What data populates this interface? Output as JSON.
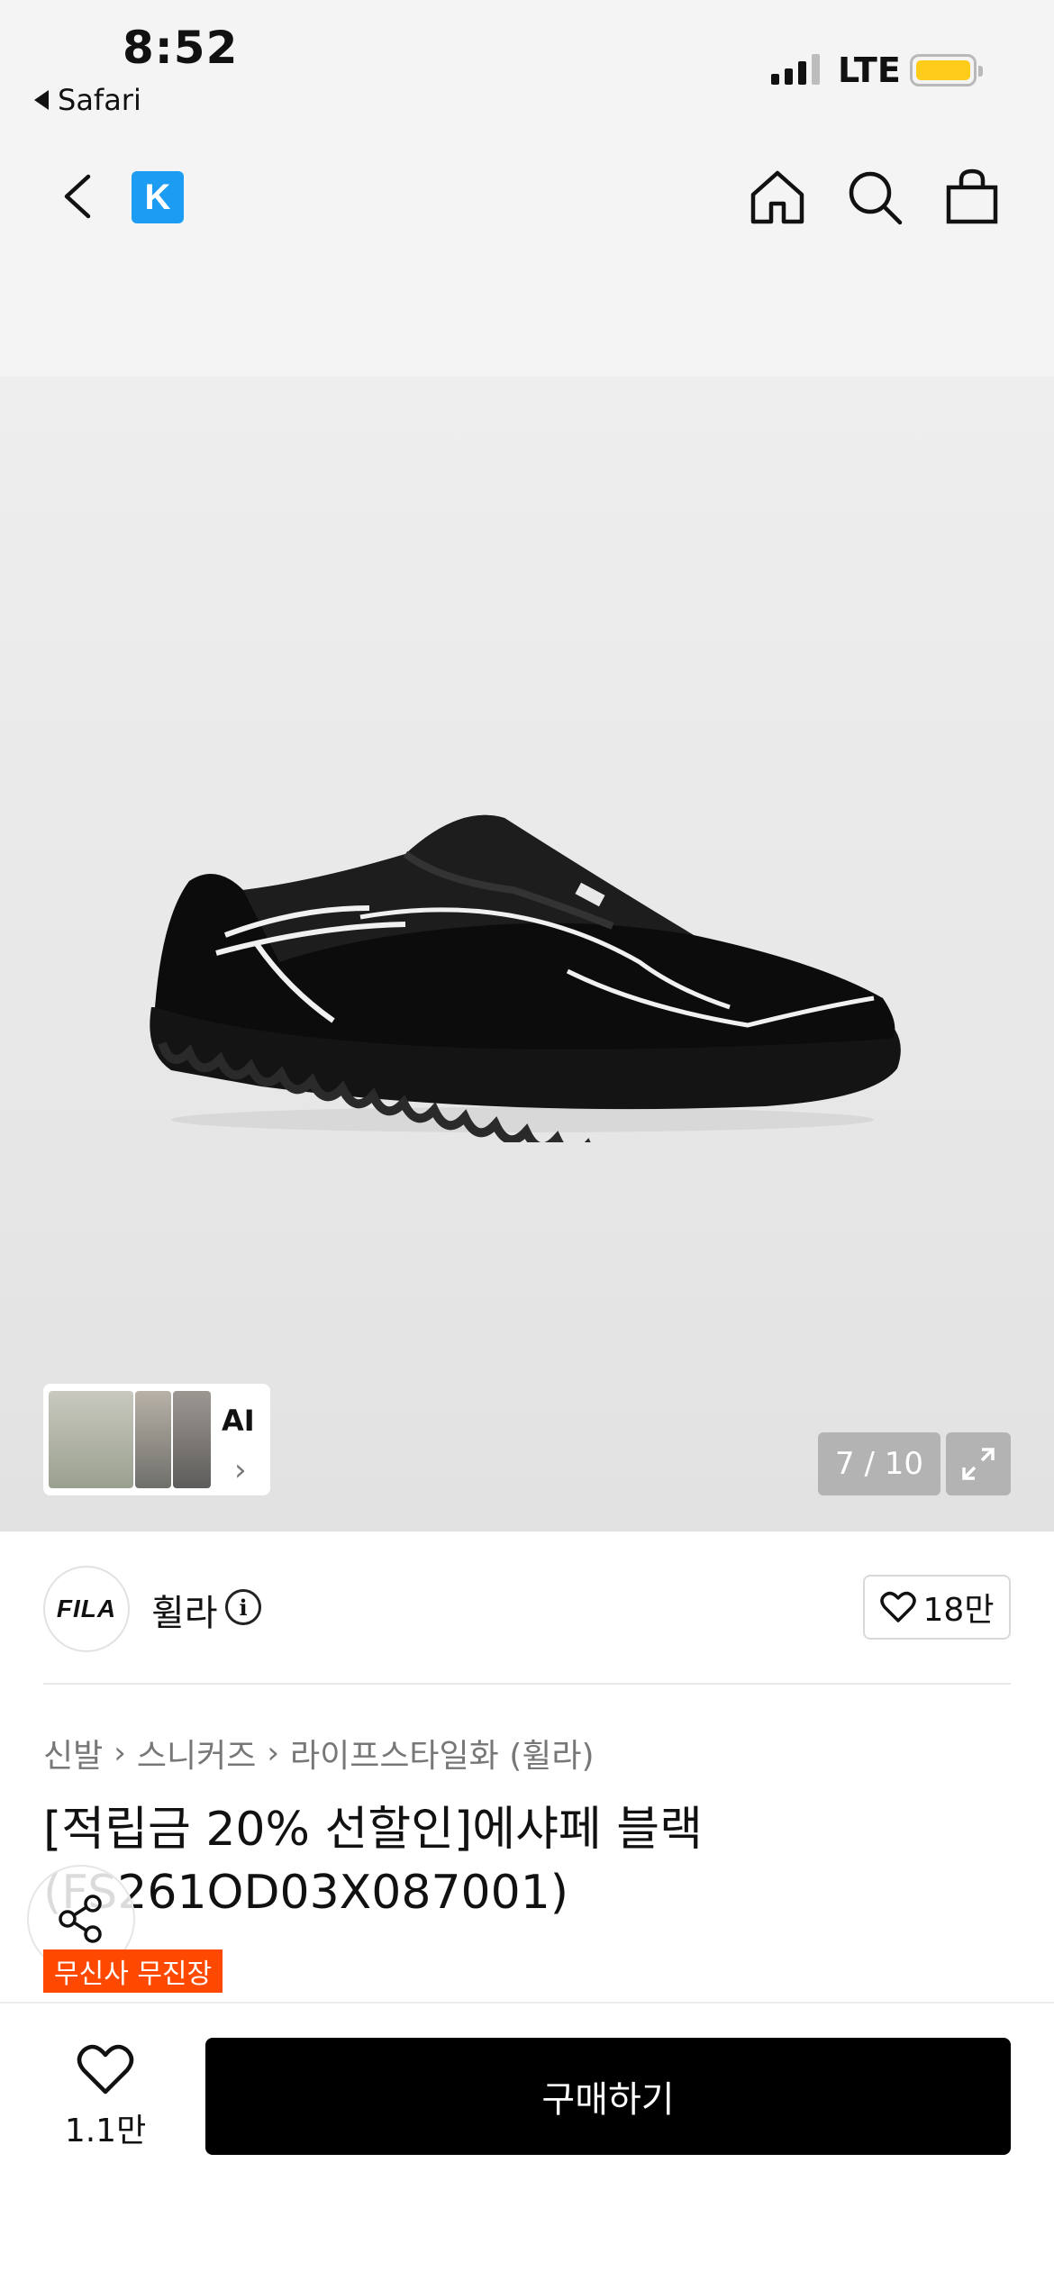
{
  "status_bar": {
    "time": "8:52",
    "back_app": "Safari",
    "network": "LTE"
  },
  "nav": {
    "logo_letter": "K",
    "icons": [
      "back-icon",
      "home-icon",
      "search-icon",
      "shopping-bag-icon"
    ]
  },
  "gallery": {
    "ai_label": "AI",
    "counter": "7 / 10"
  },
  "brand": {
    "logo_text": "FILA",
    "name": "휠라",
    "likes": "18만"
  },
  "breadcrumb": [
    "신발",
    "스니커즈",
    "라이프스타일화 (휠라)"
  ],
  "product": {
    "title": "[적립금 20% 선할인]에샤페 블랙(FS261OD03X087001)",
    "tag": "무신사 무진장"
  },
  "bottom_bar": {
    "wish_count": "1.1만",
    "buy_label": "구매하기"
  },
  "colors": {
    "brand_blue": "#1c9cf2",
    "tag_orange": "#ff4800",
    "battery_yellow": "#ffcc1a"
  }
}
